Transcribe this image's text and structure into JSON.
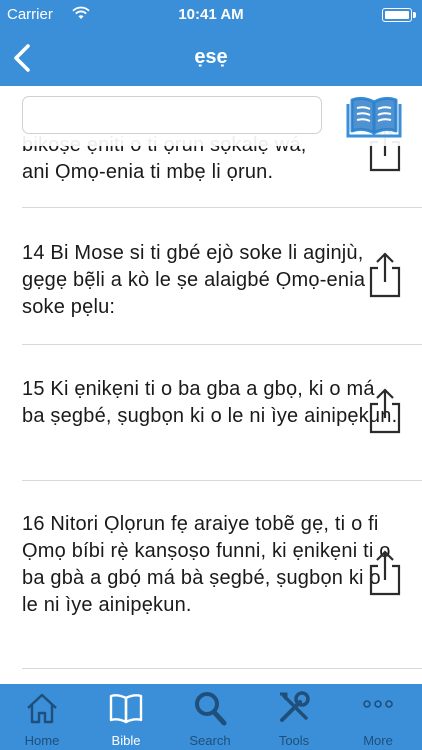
{
  "status": {
    "carrier": "Carrier",
    "time": "10:41 AM"
  },
  "nav": {
    "title": "ẹsẹ"
  },
  "search": {
    "value": "",
    "placeholder": ""
  },
  "verses": [
    {
      "text_line1": "bikoṣe ẹniti o ti ọrun sọkalẹ wá,",
      "text_line2": "ani Ọmọ-enia ti mbẹ li ọrun."
    },
    {
      "text": "14 Bi Mose si ti gbé ejò soke li aginjù, gẹgẹ bẹ̃li a kò le ṣe alaigbé Ọmọ-enia soke pẹlu:"
    },
    {
      "text": "15 Ki ẹnikẹni ti o ba gba a gbọ, ki o má ba ṣegbé, ṣugbọn ki o le ni ìye ainipẹkun."
    },
    {
      "text": "16 Nitori Ọlọrun fẹ araiye tobẽ gẹ, ti o fi Ọmọ bíbi rẹ̀ kanṣoṣo funni, ki ẹnikẹni ti o ba gbà a gbọ́ má bà ṣegbé, ṣugbọn ki o le ni ìye ainipẹkun."
    }
  ],
  "tabs": [
    {
      "label": "Home",
      "icon": "home-icon"
    },
    {
      "label": "Bible",
      "icon": "book-icon"
    },
    {
      "label": "Search",
      "icon": "search-icon"
    },
    {
      "label": "Tools",
      "icon": "tools-icon"
    },
    {
      "label": "More",
      "icon": "more-icon"
    }
  ],
  "colors": {
    "header": "#3a8fd8",
    "tab_bar": "#3a8fd8",
    "tab_inactive": "#1f4f7a",
    "tab_active": "#ffffff"
  }
}
